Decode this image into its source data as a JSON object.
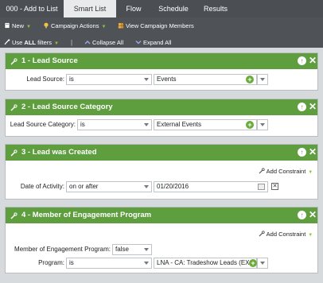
{
  "tabs": [
    {
      "label": "000 - Add to List",
      "active": false
    },
    {
      "label": "Smart List",
      "active": true
    },
    {
      "label": "Flow",
      "active": false
    },
    {
      "label": "Schedule",
      "active": false
    },
    {
      "label": "Results",
      "active": false
    }
  ],
  "toolbar": {
    "new_label": "New",
    "campaign_actions_label": "Campaign Actions",
    "view_members_label": "View Campaign Members",
    "use_all_filters_prefix": "Use ",
    "use_all_filters_bold": "ALL",
    "use_all_filters_suffix": " filters",
    "separator": "|",
    "collapse_all_label": "Collapse All",
    "expand_all_label": "Expand All"
  },
  "filters": [
    {
      "title": "1 - Lead Source",
      "rows": [
        {
          "label": "Lead Source:",
          "operator": "is",
          "value": "Events"
        }
      ]
    },
    {
      "title": "2 - Lead Source Category",
      "rows": [
        {
          "label": "Lead Source Category:",
          "operator": "is",
          "value": "External Events"
        }
      ]
    },
    {
      "title": "3 - Lead was Created",
      "add_constraint": "Add Constraint",
      "rows": [
        {
          "label": "Date of Activity:",
          "operator": "on or after",
          "value": "01/20/2016"
        }
      ]
    },
    {
      "title": "4 - Member of Engagement Program",
      "add_constraint": "Add Constraint",
      "rows": [
        {
          "label": "Member of Engagement Program:",
          "value": "false"
        },
        {
          "label": "Program:",
          "operator": "is",
          "value": "LNA - CA: Tradeshow Leads (EXA)"
        }
      ]
    }
  ],
  "colors": {
    "header_green": "#5e9e3e",
    "tab_bar": "#4b4f54",
    "accent_green": "#8cc63f"
  },
  "icons": {
    "new": "new-document-icon",
    "campaign_actions": "lightbulb-icon",
    "view_members": "people-icon",
    "use_all": "filter-icon",
    "collapse": "collapse-icon",
    "expand": "expand-icon",
    "drag": "wrench-icon",
    "up": "move-up-icon",
    "close": "close-icon",
    "add": "plus-icon",
    "calendar": "calendar-icon",
    "clear": "clear-icon"
  }
}
